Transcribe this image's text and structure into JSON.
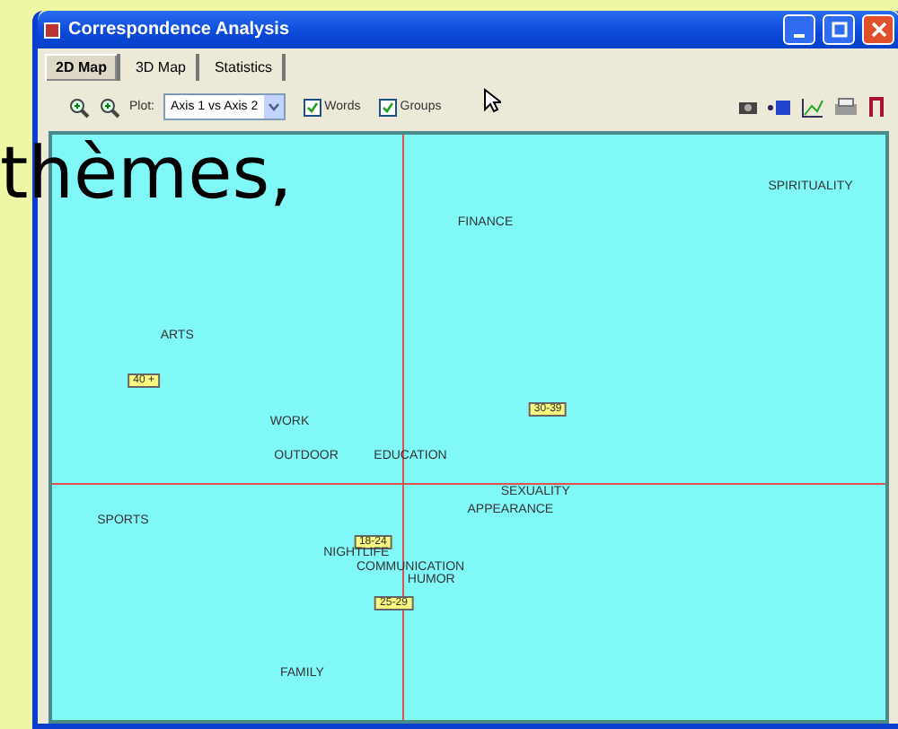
{
  "slide_text": "thèmes,",
  "window": {
    "title": "Correspondence Analysis"
  },
  "tabs": [
    {
      "label": "2D Map",
      "selected": true
    },
    {
      "label": "3D Map",
      "selected": false
    },
    {
      "label": "Statistics",
      "selected": false
    }
  ],
  "toolbar": {
    "plot_label": "Plot:",
    "plot_value": "Axis 1 vs Axis 2",
    "checkboxes": [
      {
        "label": "Words",
        "checked": true
      },
      {
        "label": "Groups",
        "checked": true
      }
    ]
  },
  "map": {
    "points": [
      {
        "label": "SPIRITUALITY",
        "kind": "word"
      },
      {
        "label": "FINANCE",
        "kind": "word"
      },
      {
        "label": "ARTS",
        "kind": "word"
      },
      {
        "label": "40 +",
        "kind": "group"
      },
      {
        "label": "WORK",
        "kind": "word"
      },
      {
        "label": "30-39",
        "kind": "group"
      },
      {
        "label": "OUTDOOR",
        "kind": "word"
      },
      {
        "label": "EDUCATION",
        "kind": "word"
      },
      {
        "label": "SEXUALITY",
        "kind": "word"
      },
      {
        "label": "APPEARANCE",
        "kind": "word"
      },
      {
        "label": "SPORTS",
        "kind": "word"
      },
      {
        "label": "18-24",
        "kind": "group"
      },
      {
        "label": "NIGHTLIFE",
        "kind": "word"
      },
      {
        "label": "COMMUNICATION",
        "kind": "word"
      },
      {
        "label": "HUMOR",
        "kind": "word"
      },
      {
        "label": "25-29",
        "kind": "group"
      },
      {
        "label": "FAMILY",
        "kind": "word"
      }
    ]
  }
}
